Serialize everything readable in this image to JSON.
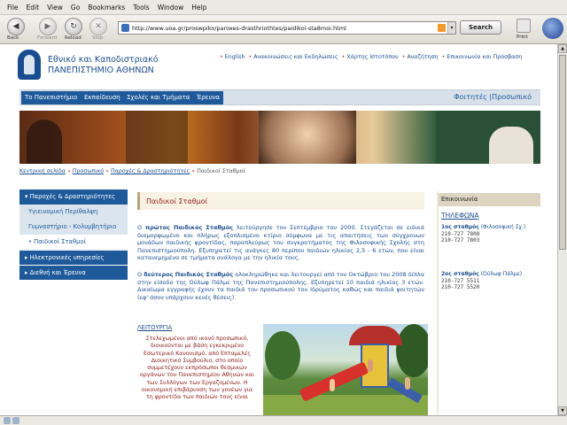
{
  "browser": {
    "menu": [
      "File",
      "Edit",
      "View",
      "Go",
      "Bookmarks",
      "Tools",
      "Window",
      "Help"
    ],
    "nav": {
      "back": "Back",
      "forward": "Forward",
      "reload": "Reload",
      "stop": "Stop"
    },
    "url": "http://www.uoa.gr/proswpiko/paroxes-drasthriothtes/paidikoi-sta8moi.html",
    "search_label": "Search",
    "print_label": "Print"
  },
  "site": {
    "name_line1": "Εθνικό και Καποδιστριακό",
    "name_line2": "ΠΑΝΕΠΙΣΤΗΜΙΟ ΑΘΗΝΩΝ",
    "top_links": [
      "English",
      "Ανακοινώσεις και Εκδηλώσεις",
      "Χάρτης Ιστοτόπου",
      "Αναζήτηση",
      "Επικοινωνία και Πρόσβαση"
    ],
    "main_nav": [
      "Το Πανεπιστήμιο",
      "Εκπαίδευση",
      "Σχολές και Τμήματα",
      "Έρευνα"
    ],
    "audience_students": "Φοιτητές",
    "audience_sep": "|",
    "audience_staff": "Προσωπικό"
  },
  "breadcrumb": [
    "Κεντρική σελίδα",
    "Προσωπικό",
    "Παροχές & Δραστηριότητες",
    "Παιδικοί Σταθμοί"
  ],
  "sidebar": {
    "items": [
      {
        "label": "▾ Παροχές & Δραστηριότητες"
      },
      {
        "label": "Υγιεινομική Περίθαλψη"
      },
      {
        "label": "Γυμναστήριο - Κολυμβητήριο"
      },
      {
        "label": "• Παιδικοί Σταθμοί"
      },
      {
        "label": "▸ Ηλεκτρονικές υπηρεσίες"
      },
      {
        "label": "▸ Διεθνή και Έρευνα"
      }
    ]
  },
  "content": {
    "title": "Παιδικοί Σταθμοί",
    "p1_bold": "πρώτος Παιδικός Σταθμός",
    "p1_pre": "Ο ",
    "p1_rest": " λειτούργησε τον Σεπτέμβριο του 2000. Στεγάζεται σε ειδικά διαμορφωμένο και πλήρως εξοπλισμένο κτίριο σύμφωνα με τις απαιτήσεις των σύγχρονων μονάδων παιδικής φροντίδας, παραπλεύρως του συγκροτήματος της Φιλοσοφικής Σχολής στη Πανεπιστημιούπολη. Εξυπηρετεί τις ανάγκες 80 περίπου παιδιών ηλικίας 2,5 - 6 ετών, που είναι κατανεμημένα σε τμήματα ανάλογα με την ηλικία τους.",
    "p2_pre": "Ο ",
    "p2_bold": "δεύτερος Παιδικός Σταθμός",
    "p2_rest": " ολοκληρώθηκε και λειτουργεί από τον Οκτώβριο του 2008 δίπλα στην είσοδο της Ούλωφ Πάλμε της Πανεπιστημιούπολης. Εξυπηρετεί 10 παιδιά ηλικίας 3 ετών. Δικαίωμα εγγραφής έχουν τα παιδιά του προσωπικού του Ιδρύματος καθώς και παιδιά φοιτητών (εφ' όσον υπάρχουν κενές θέσεις).",
    "section_heading": "ΛΕΙΤΟΥΡΓΙΑ",
    "section_text": "Στελεχωμένοι από ικανό προσωπικό, διοικούνται με βάση εγκεκριμένο Εσωτερικό Κανονισμό, από Επταμελές Διοικητικό Συμβούλιο, στο οποίο συμμετέχουν εκπρόσωποι θεσμικών οργάνων του Πανεπιστημίου Αθηνών και των Συλλόγων των Εργαζομένων. Η οικονομική επιβάρυνση των γονέων για τη φροντίδα των παιδιών τους είναι"
  },
  "contact": {
    "heading": "Επικοινωνία",
    "phone_title": "ΤΗΛΕΦΩΝΑ",
    "station1_name": "1ος σταθμός",
    "station1_loc": " (Φιλοσοφική Σχ.)",
    "station1_phones": [
      "210-727 7808",
      "210-727 7803"
    ],
    "station2_name": "2ος σταθμός",
    "station2_loc": " (Ούλωφ Πάλμε)",
    "station2_phones": [
      "210-727 5511",
      "210-727 5520"
    ]
  },
  "colors": {
    "brand_blue": "#1e5a9a",
    "title_red": "#8c1b1b",
    "accent_red": "#c83a2b"
  }
}
